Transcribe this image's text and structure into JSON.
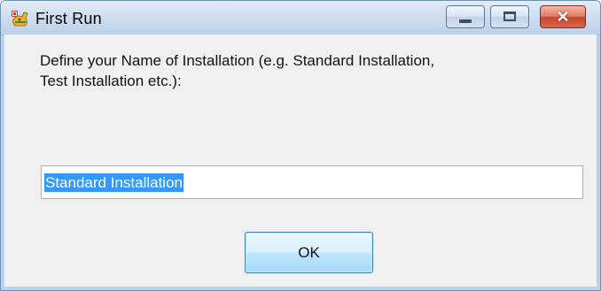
{
  "window": {
    "title": "First Run",
    "controls": {
      "minimize_icon": "minimize-icon",
      "maximize_icon": "maximize-icon",
      "close_icon": "close-icon",
      "close_glyph": "✕"
    }
  },
  "dialog": {
    "prompt_line1": "Define your Name of Installation (e.g. Standard Installation,",
    "prompt_line2": "Test Installation etc.):",
    "name_input": {
      "value": "Standard Installation",
      "selected": true
    },
    "ok_label": "OK"
  },
  "colors": {
    "selection": "#3399ff",
    "close_button": "#c7452b",
    "frame": "#bcd1ea"
  }
}
